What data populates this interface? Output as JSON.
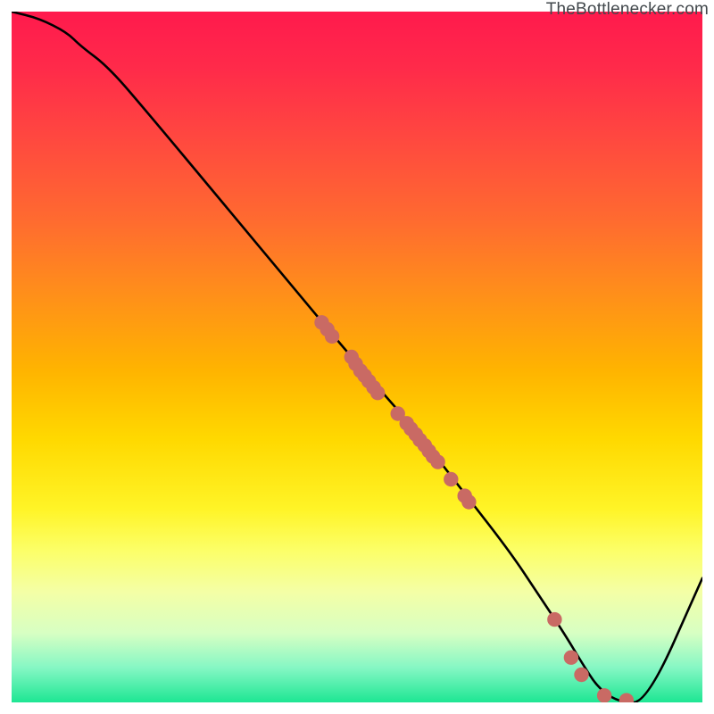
{
  "attribution": "TheBottlenecker.com",
  "colors": {
    "curve": "#000000",
    "marker_fill": "#c96a64",
    "marker_stroke": "#a94f49",
    "gradient_top": "#ff1a4d",
    "gradient_bottom": "#1de693"
  },
  "chart_data": {
    "type": "line",
    "title": "",
    "xlabel": "",
    "ylabel": "",
    "xlim": [
      0,
      100
    ],
    "ylim": [
      0,
      100
    ],
    "series": [
      {
        "name": "bottleneck-curve",
        "x": [
          0,
          4,
          8,
          10,
          14,
          20,
          30,
          40,
          50,
          58,
          65,
          72,
          76,
          80,
          83,
          85,
          88,
          92,
          100
        ],
        "y": [
          100,
          99,
          97,
          95,
          92,
          85,
          73,
          61,
          49,
          40,
          31,
          22,
          16,
          10,
          5,
          2,
          0,
          0,
          18
        ]
      }
    ],
    "markers": [
      {
        "group": 1,
        "x": 44.9,
        "y": 55.0
      },
      {
        "group": 1,
        "x": 45.7,
        "y": 54.0
      },
      {
        "group": 1,
        "x": 46.4,
        "y": 53.0
      },
      {
        "group": 1,
        "x": 49.2,
        "y": 50.0
      },
      {
        "group": 1,
        "x": 49.8,
        "y": 49.0
      },
      {
        "group": 1,
        "x": 50.5,
        "y": 48.0
      },
      {
        "group": 1,
        "x": 51.1,
        "y": 47.3
      },
      {
        "group": 1,
        "x": 51.7,
        "y": 46.5
      },
      {
        "group": 1,
        "x": 52.4,
        "y": 45.6
      },
      {
        "group": 1,
        "x": 53.0,
        "y": 44.8
      },
      {
        "group": 1,
        "x": 55.9,
        "y": 41.8
      },
      {
        "group": 1,
        "x": 57.2,
        "y": 40.4
      },
      {
        "group": 1,
        "x": 57.8,
        "y": 39.6
      },
      {
        "group": 1,
        "x": 58.5,
        "y": 38.8
      },
      {
        "group": 1,
        "x": 59.1,
        "y": 38.0
      },
      {
        "group": 1,
        "x": 59.8,
        "y": 37.2
      },
      {
        "group": 1,
        "x": 60.4,
        "y": 36.4
      },
      {
        "group": 1,
        "x": 61.0,
        "y": 35.6
      },
      {
        "group": 1,
        "x": 61.7,
        "y": 34.8
      },
      {
        "group": 1,
        "x": 63.6,
        "y": 32.3
      },
      {
        "group": 1,
        "x": 65.6,
        "y": 29.9
      },
      {
        "group": 1,
        "x": 66.2,
        "y": 29.0
      },
      {
        "group": 2,
        "x": 78.6,
        "y": 12.0
      },
      {
        "group": 2,
        "x": 81.0,
        "y": 6.5
      },
      {
        "group": 2,
        "x": 82.5,
        "y": 4.0
      },
      {
        "group": 2,
        "x": 85.8,
        "y": 1.0
      },
      {
        "group": 2,
        "x": 89.0,
        "y": 0.3
      }
    ]
  }
}
